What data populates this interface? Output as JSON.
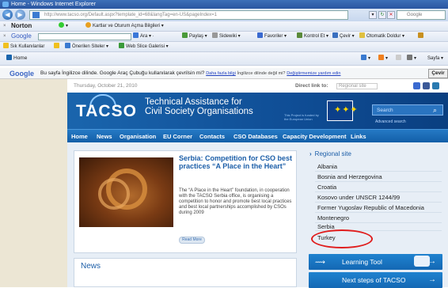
{
  "browser": {
    "title": "Home - Windows Internet Explorer",
    "url": "http://www.tacso.org/Default.aspx?template_id=68&langTag=en-US&pageIndex=1",
    "search_placeholder": "Google"
  },
  "norton_bar": {
    "brand": "Norton",
    "item_cards": "Kartlar ve Oturum Açma Bilgileri"
  },
  "google_bar": {
    "logo": "Google",
    "search": "Ara",
    "share": "Paylaş",
    "sidewiki": "Sidewiki",
    "favorites": "Favoriler",
    "spellcheck": "Kontrol Et",
    "translate": "Çevir",
    "autofill": "Otomatik Doldur"
  },
  "favorites_bar": {
    "favorites": "Sık Kullanılanlar",
    "suggested": "Önerilen Siteler",
    "webslice": "Web Slice Galerisi"
  },
  "tab_bar": {
    "tab_title": "Home",
    "page_menu": "Sayfa"
  },
  "translate_bar": {
    "logo": "Google",
    "message": "Bu sayfa İngilizce dilinde. Google Araç Çubuğu kullanılarak çevrilsin mi?",
    "more_info": "Daha fazla bilgi",
    "hint": "İngilizce dilinde değil mi?",
    "fix": "Değiştirmemize yardım edin",
    "button": "Çevir"
  },
  "site": {
    "date": "Thursday, October 21, 2010",
    "direct_link": "Direct link to:",
    "region_select": "Regional site",
    "logo": "TACSO",
    "tagline_line1": "Technical Assistance for",
    "tagline_line2": "Civil Society Organisations",
    "eu_text": "This Project is funded by the European Union",
    "search_label": "Search",
    "advanced_search": "Advanced search",
    "nav": [
      "Home",
      "News",
      "Organisation",
      "EU Corner",
      "Contacts",
      "CSO Databases",
      "Capacity Development",
      "Links"
    ]
  },
  "feature": {
    "title": "Serbia: Competition for CSO best practices “A Place in the Heart”",
    "text": "The “A Place in the Heart” foundation, in cooperation with the TACSO Serbia office, is organising a competition to honor and promote best local practices and best local partnerships accomplished by CSOs during 2009",
    "read_more": "Read More"
  },
  "news": {
    "heading": "News"
  },
  "regional": {
    "heading": "Regional site",
    "items": [
      "Albania",
      "Bosnia and Herzegovina",
      "Croatia",
      "Kosovo under UNSCR 1244/99",
      "Former Yugoslav Republic of Macedonia",
      "Montenegro",
      "Serbia",
      "Turkey"
    ]
  },
  "buttons": {
    "learning_tool": "Learning Tool",
    "next_steps": "Next steps of TACSO"
  },
  "colors": {
    "site_blue": "#135fa8",
    "highlight_circle": "#e01d1d"
  }
}
